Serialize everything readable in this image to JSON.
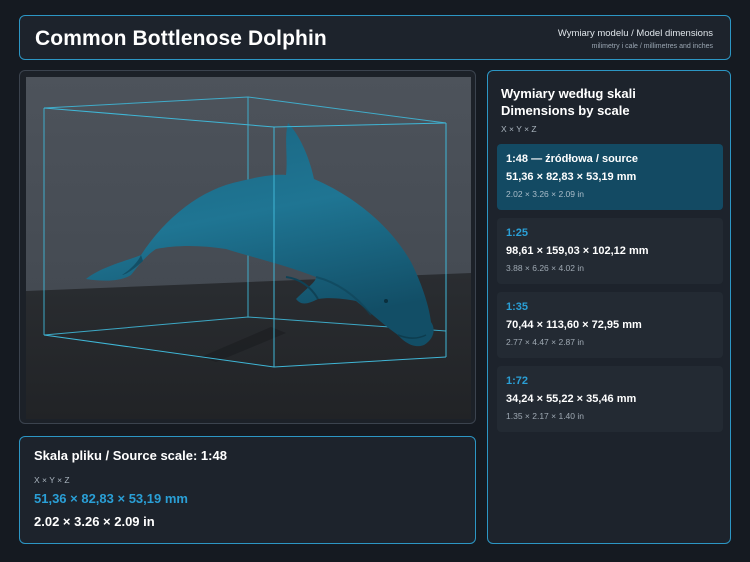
{
  "header": {
    "title": "Common Bottlenose Dolphin",
    "subtitle": "Wymiary modelu / Model dimensions",
    "units_note": "milimetry i cale / millimetres and inches"
  },
  "source": {
    "title": "Skala pliku / Source scale: 1:48",
    "axes": "X × Y × Z",
    "mm": "51,36 × 82,83 × 53,19 mm",
    "inches": "2.02 × 3.26 × 2.09 in"
  },
  "scales": {
    "heading_pl": "Wymiary według skali",
    "heading_en": "Dimensions by scale",
    "axes": "X × Y × Z",
    "items": [
      {
        "label": "1:48  —  źródłowa / source",
        "mm": "51,36 × 82,83 × 53,19 mm",
        "inches": "2.02 × 3.26 × 2.09 in",
        "active": true
      },
      {
        "label": "1:25",
        "mm": "98,61 × 159,03 × 102,12 mm",
        "inches": "3.88 × 6.26 × 4.02 in",
        "active": false
      },
      {
        "label": "1:35",
        "mm": "70,44 × 113,60 × 72,95 mm",
        "inches": "2.77 × 4.47 × 2.87 in",
        "active": false
      },
      {
        "label": "1:72",
        "mm": "34,24 × 55,22 × 35,46 mm",
        "inches": "1.35 × 2.17 × 1.40 in",
        "active": false
      }
    ]
  },
  "colors": {
    "accent": "#2a9fd6",
    "panel_border": "#2c96c4",
    "active_card": "#134a63",
    "model": "#1f6f8b"
  }
}
